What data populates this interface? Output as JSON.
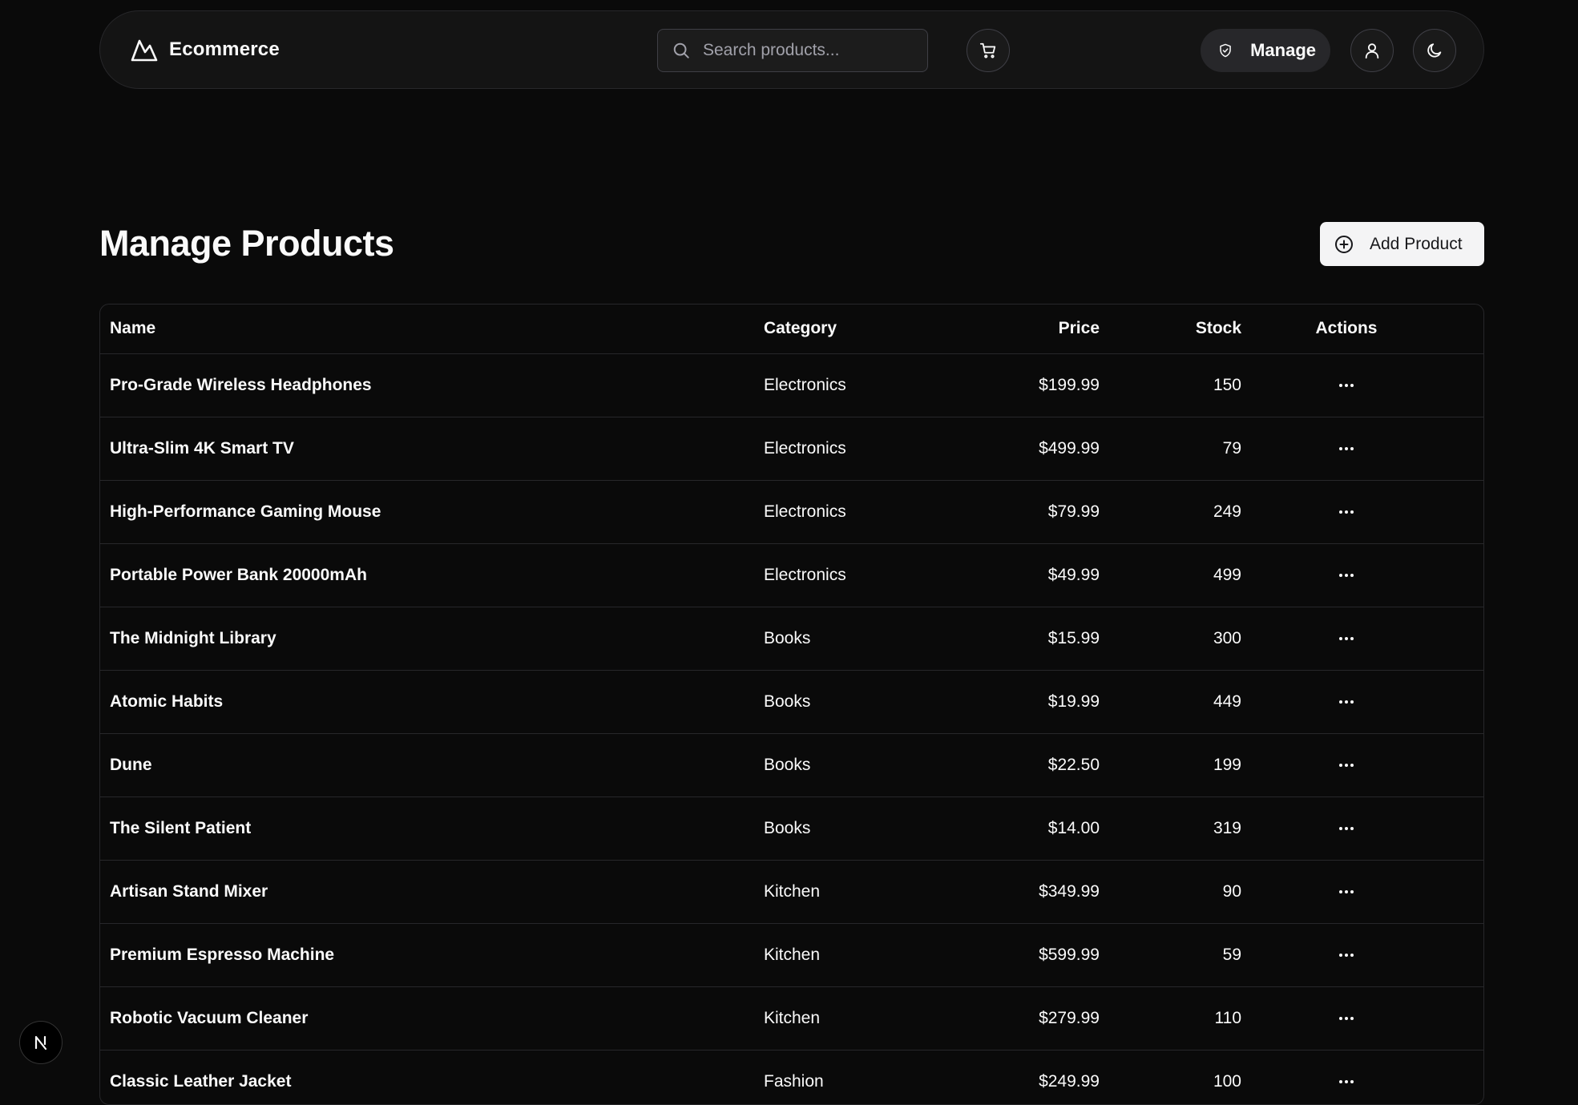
{
  "header": {
    "brand": "Ecommerce",
    "search_placeholder": "Search products...",
    "manage_label": "Manage"
  },
  "page": {
    "title": "Manage Products",
    "add_button_label": "Add Product"
  },
  "table": {
    "columns": {
      "name": "Name",
      "category": "Category",
      "price": "Price",
      "stock": "Stock",
      "actions": "Actions"
    },
    "rows": [
      {
        "name": "Pro-Grade Wireless Headphones",
        "category": "Electronics",
        "price": "$199.99",
        "stock": "150"
      },
      {
        "name": "Ultra-Slim 4K Smart TV",
        "category": "Electronics",
        "price": "$499.99",
        "stock": "79"
      },
      {
        "name": "High-Performance Gaming Mouse",
        "category": "Electronics",
        "price": "$79.99",
        "stock": "249"
      },
      {
        "name": "Portable Power Bank 20000mAh",
        "category": "Electronics",
        "price": "$49.99",
        "stock": "499"
      },
      {
        "name": "The Midnight Library",
        "category": "Books",
        "price": "$15.99",
        "stock": "300"
      },
      {
        "name": "Atomic Habits",
        "category": "Books",
        "price": "$19.99",
        "stock": "449"
      },
      {
        "name": "Dune",
        "category": "Books",
        "price": "$22.50",
        "stock": "199"
      },
      {
        "name": "The Silent Patient",
        "category": "Books",
        "price": "$14.00",
        "stock": "319"
      },
      {
        "name": "Artisan Stand Mixer",
        "category": "Kitchen",
        "price": "$349.99",
        "stock": "90"
      },
      {
        "name": "Premium Espresso Machine",
        "category": "Kitchen",
        "price": "$599.99",
        "stock": "59"
      },
      {
        "name": "Robotic Vacuum Cleaner",
        "category": "Kitchen",
        "price": "$279.99",
        "stock": "110"
      },
      {
        "name": "Classic Leather Jacket",
        "category": "Fashion",
        "price": "$249.99",
        "stock": "100"
      }
    ]
  },
  "icons": {
    "logo": "mountain-logo-icon",
    "search": "search-icon",
    "cart": "cart-icon",
    "manage": "shield-icon",
    "user": "user-icon",
    "theme": "moon-icon",
    "add": "plus-circle-icon",
    "row_actions": "more-horizontal-icon",
    "dev_badge": "nextjs-icon"
  },
  "colors": {
    "background": "#0a0a0a",
    "header_bg": "#141414",
    "border": "#27272a",
    "text": "#fafafa",
    "add_button_bg": "#f4f4f5"
  }
}
